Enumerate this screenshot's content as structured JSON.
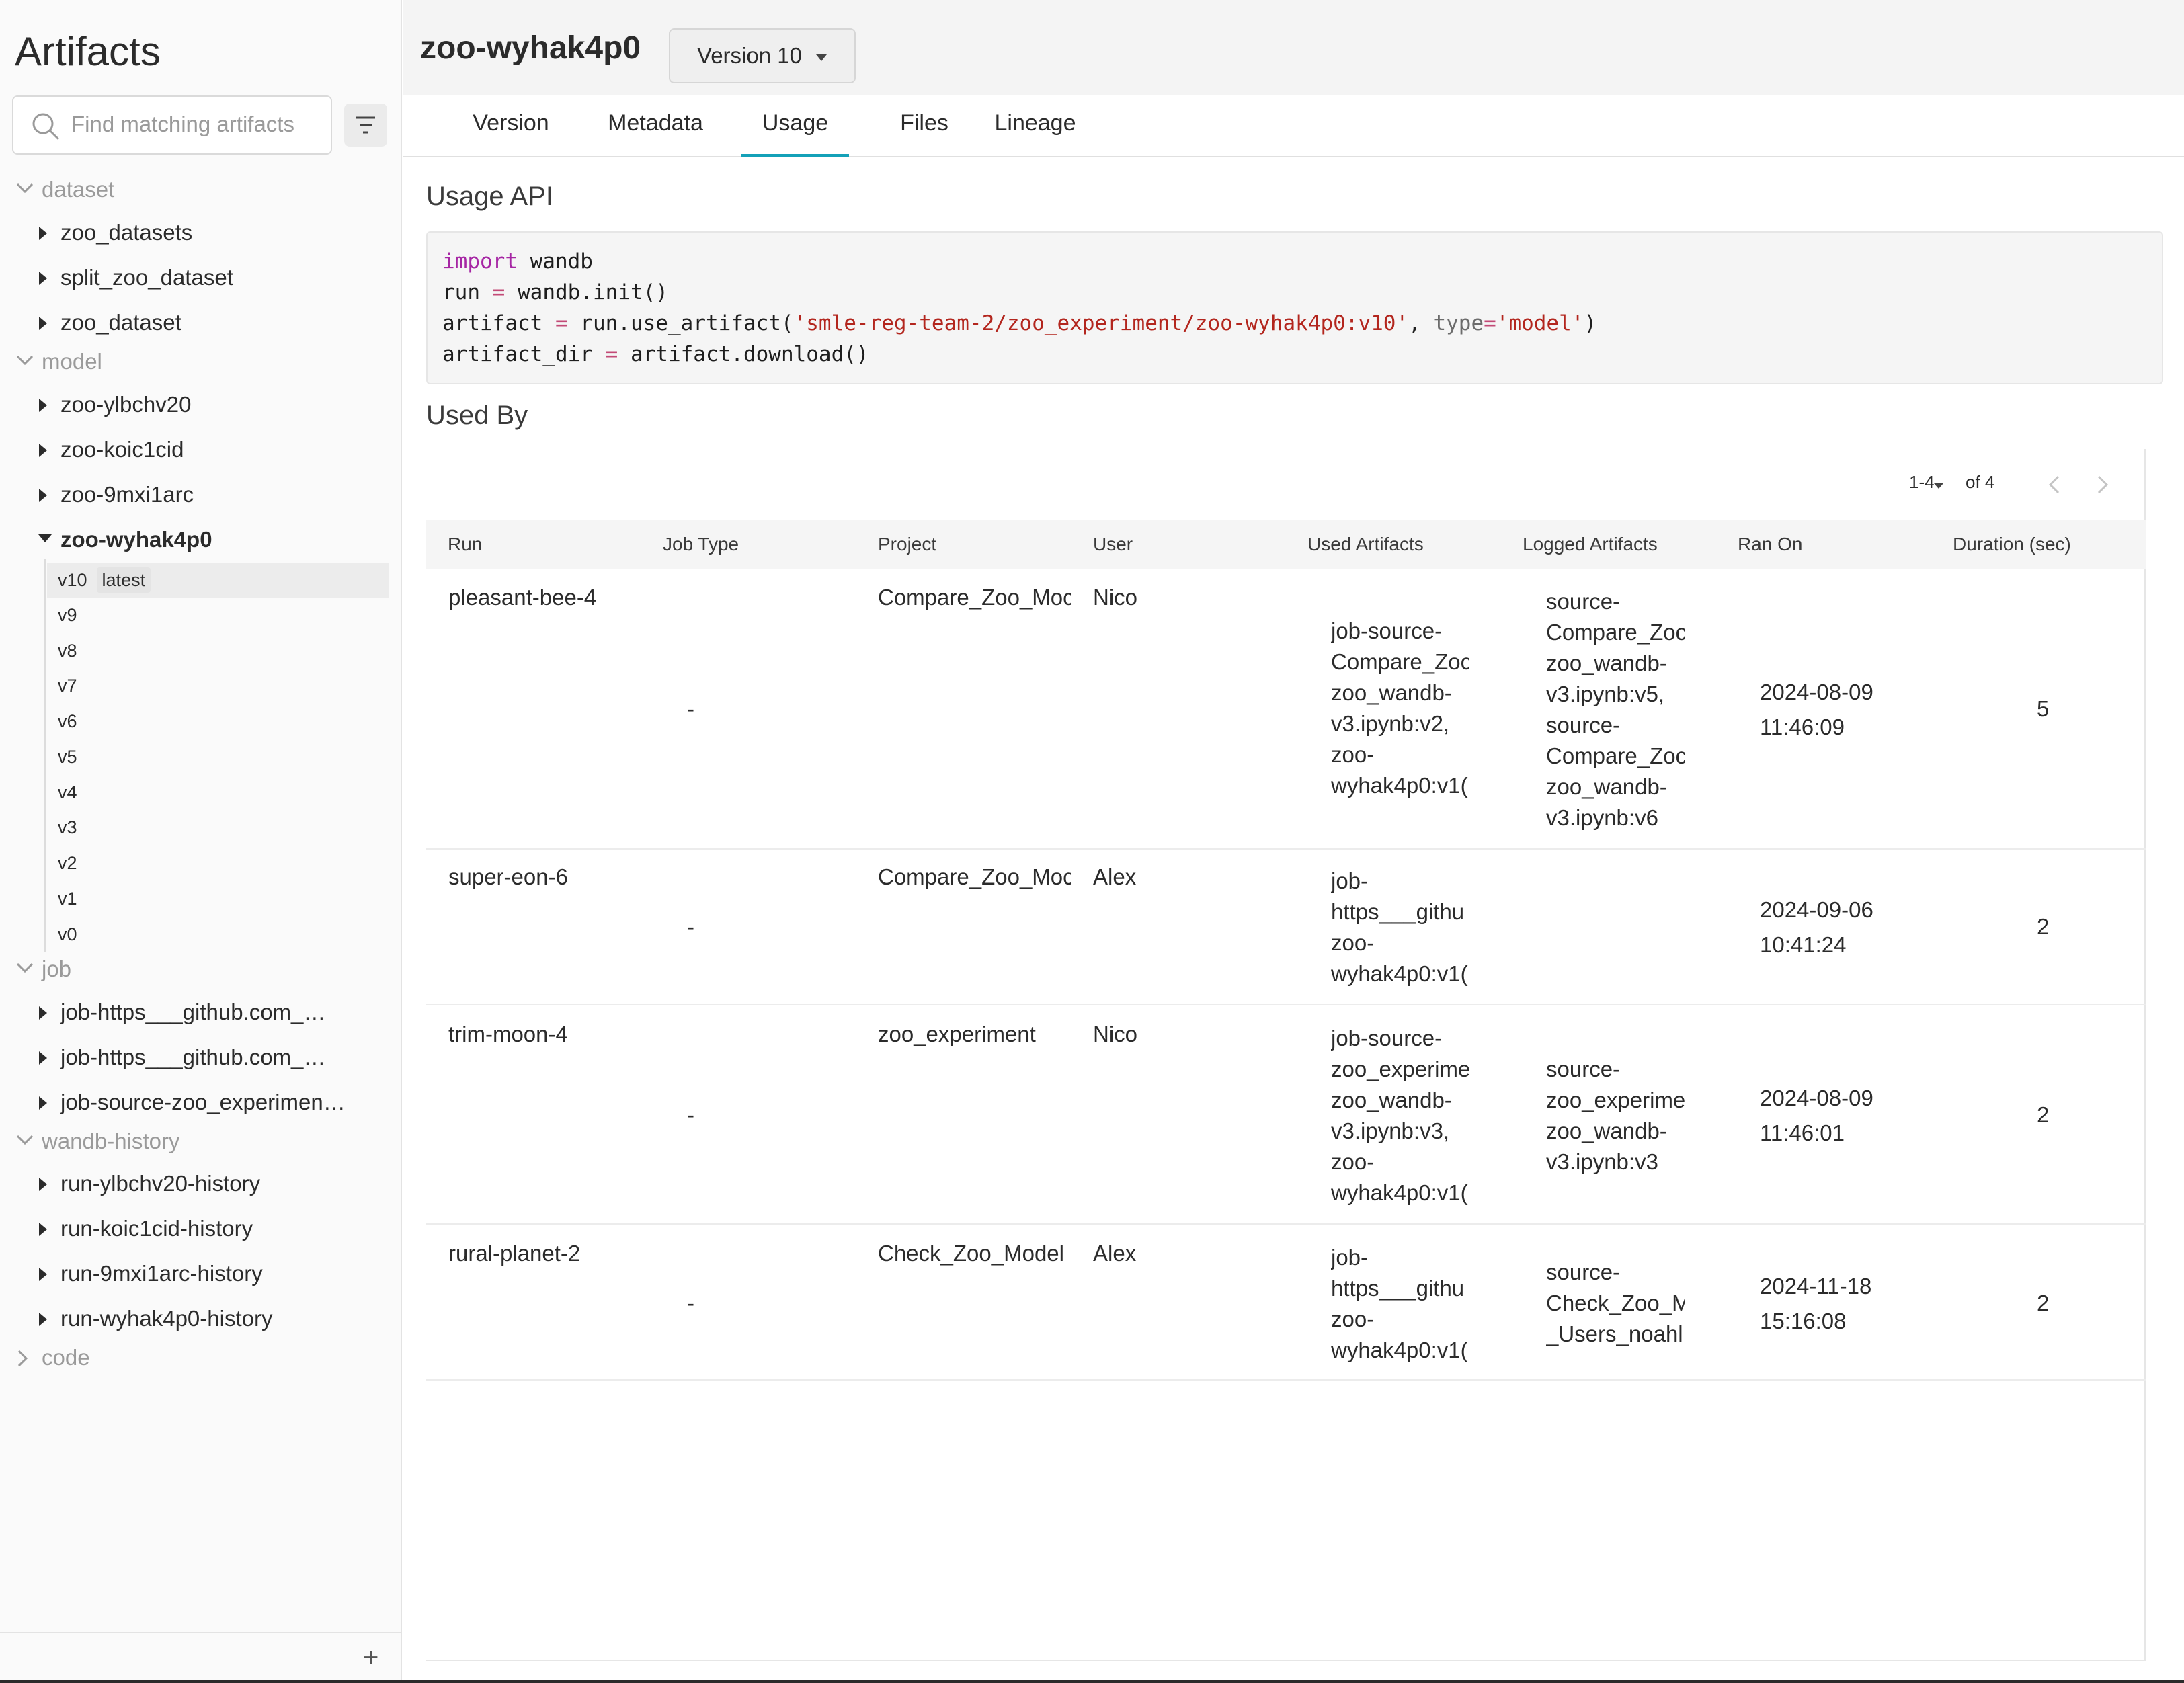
{
  "sidebar": {
    "title": "Artifacts",
    "search_placeholder": "Find matching artifacts",
    "categories": {
      "dataset": {
        "label": "dataset",
        "items": [
          "zoo_datasets",
          "split_zoo_dataset",
          "zoo_dataset"
        ]
      },
      "model": {
        "label": "model",
        "items": [
          "zoo-ylbchv20",
          "zoo-koic1cid",
          "zoo-9mxi1arc",
          "zoo-wyhak4p0"
        ],
        "versions": [
          "v10",
          "v9",
          "v8",
          "v7",
          "v6",
          "v5",
          "v4",
          "v3",
          "v2",
          "v1",
          "v0"
        ],
        "latest_label": "latest"
      },
      "job": {
        "label": "job",
        "items": [
          "job-https___github.com_…",
          "job-https___github.com_…",
          "job-source-zoo_experimen…"
        ]
      },
      "wandb_history": {
        "label": "wandb-history",
        "items": [
          "run-ylbchv20-history",
          "run-koic1cid-history",
          "run-9mxi1arc-history",
          "run-wyhak4p0-history"
        ]
      },
      "code": {
        "label": "code"
      }
    },
    "add_label": "+"
  },
  "header": {
    "artifact_name": "zoo-wyhak4p0",
    "version_select": "Version 10"
  },
  "tabs": [
    "Version",
    "Metadata",
    "Usage",
    "Files",
    "Lineage"
  ],
  "active_tab": "Usage",
  "usage": {
    "title": "Usage API",
    "code": {
      "l1_kw": "import",
      "l1_rest": " wandb",
      "l2_a": "run ",
      "l2_op": "=",
      "l2_b": " wandb.init()",
      "l3_a": "artifact ",
      "l3_op": "=",
      "l3_b": " run.use_artifact(",
      "l3_str": "'smle-reg-team-2/zoo_experiment/zoo-wyhak4p0:v10'",
      "l3_c": ", ",
      "l3_param": "type",
      "l3_op2": "=",
      "l3_str2": "'model'",
      "l3_d": ")",
      "l4_a": "artifact_dir ",
      "l4_op": "=",
      "l4_b": " artifact.download()"
    }
  },
  "used_by": {
    "title": "Used By",
    "pager": {
      "range": "1-4",
      "of": "of 4"
    },
    "columns": [
      "Run",
      "Job Type",
      "Project",
      "User",
      "Used Artifacts",
      "Logged Artifacts",
      "Ran On",
      "Duration (sec)"
    ],
    "rows": [
      {
        "run": "pleasant-bee-4",
        "job_type": "-",
        "project": "Compare_Zoo_Moc",
        "user": "Nico",
        "used": [
          "job-source-",
          "Compare_Zoc",
          "zoo_wandb-",
          "v3.ipynb:v2,",
          "zoo-",
          "wyhak4p0:v1("
        ],
        "logged": [
          "source-",
          "Compare_Zoc",
          "zoo_wandb-",
          "v3.ipynb:v5,",
          "source-",
          "Compare_Zoc",
          "zoo_wandb-",
          "v3.ipynb:v6"
        ],
        "date": "2024-08-09",
        "time": "11:46:09",
        "duration": "5"
      },
      {
        "run": "super-eon-6",
        "job_type": "-",
        "project": "Compare_Zoo_Moc",
        "user": "Alex",
        "used": [
          "job-",
          "https___githu",
          "zoo-",
          "wyhak4p0:v1("
        ],
        "logged": [],
        "date": "2024-09-06",
        "time": "10:41:24",
        "duration": "2"
      },
      {
        "run": "trim-moon-4",
        "job_type": "-",
        "project": "zoo_experiment",
        "user": "Nico",
        "used": [
          "job-source-",
          "zoo_experime",
          "zoo_wandb-",
          "v3.ipynb:v3,",
          "zoo-",
          "wyhak4p0:v1("
        ],
        "logged": [
          "source-",
          "zoo_experime",
          "zoo_wandb-",
          "v3.ipynb:v3"
        ],
        "date": "2024-08-09",
        "time": "11:46:01",
        "duration": "2"
      },
      {
        "run": "rural-planet-2",
        "job_type": "-",
        "project": "Check_Zoo_Model",
        "user": "Alex",
        "used": [
          "job-",
          "https___githu",
          "zoo-",
          "wyhak4p0:v1("
        ],
        "logged": [
          "source-",
          "Check_Zoo_M",
          "_Users_noahl"
        ],
        "date": "2024-11-18",
        "time": "15:16:08",
        "duration": "2"
      }
    ]
  }
}
